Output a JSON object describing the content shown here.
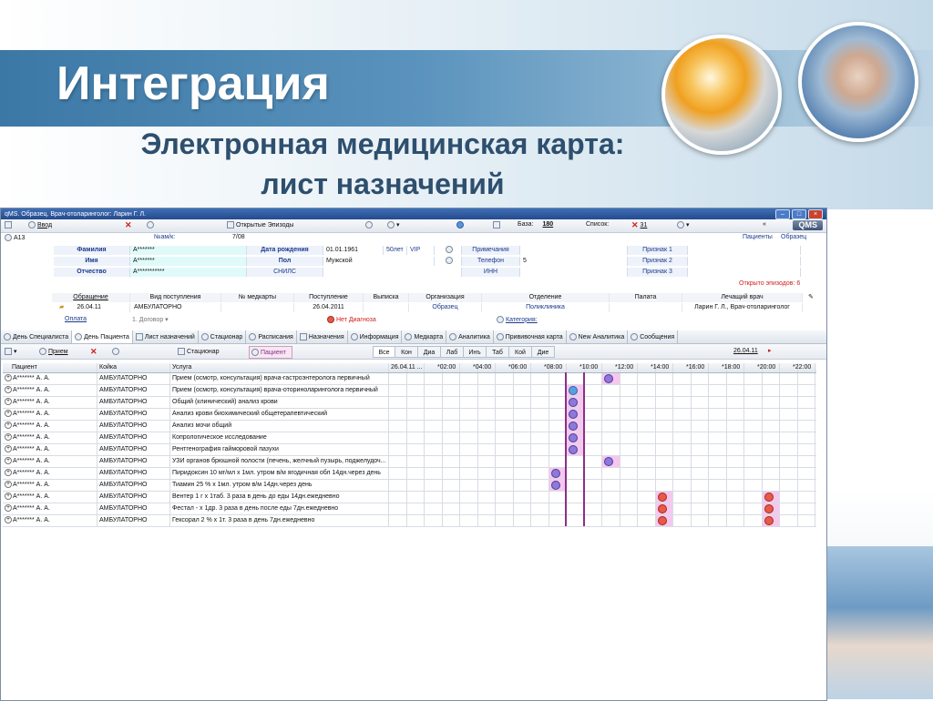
{
  "slide": {
    "title": "Интеграция",
    "subtitle_line1": "Электронная медицинская карта:",
    "subtitle_line2": "лист назначений"
  },
  "window": {
    "title": "qMS. Образец. Врач-отоларинголог: Ларин Г. Л.",
    "logo": "QMS"
  },
  "toolbar": {
    "vvod": "Ввод",
    "open_episodes": "Открытые Эпизоды",
    "baza_label": "База:",
    "baza_value": "180",
    "spisok_label": "Список:",
    "spisok_value": "31"
  },
  "patient": {
    "a13": "A13",
    "nam_label": "№ам/к:",
    "nam_value": "7/08",
    "links_right": [
      "Пациенты",
      "Образец"
    ],
    "fields": [
      {
        "label": "Фамилия",
        "value": "А*******"
      },
      {
        "label": "Имя",
        "value": "А*******"
      },
      {
        "label": "Отчество",
        "value": "А***********"
      }
    ],
    "dob_label": "Дата рождения",
    "dob_value": "01.01.1961",
    "age": "50лет",
    "vip": "VIP",
    "sex_label": "Пол",
    "sex_value": "Мужской",
    "snils_label": "СНИЛС",
    "notes_label": "Примечания",
    "phone_label": "Телефон",
    "phone_value": "5",
    "inn_label": "ИНН",
    "signs": [
      "Признак 1",
      "Признак 2",
      "Признак 3"
    ],
    "open_episodes_note": "Открыто эпизодов: 6"
  },
  "episode": {
    "headers": [
      "Обращение",
      "Вид поступления",
      "№ медкарты",
      "Поступление",
      "Выписка",
      "Организация",
      "Отделение",
      "Палата",
      "Лечащий врач"
    ],
    "row": {
      "date": "26.04.11",
      "type": "АМБУЛАТОРНО",
      "admission": "26.04.2011",
      "organization": "Образец",
      "department": "Поликлиника",
      "doctor": "Ларин Г. Л., Врач-отоларинголог"
    },
    "payment": "Оплата",
    "contract": "1. Договор",
    "no_diagnosis": "Нет Диагноза",
    "category": "Категория:"
  },
  "tabs": [
    "День Специалиста",
    "День Пациента",
    "Лист назначений",
    "Стационар",
    "Расписания",
    "Назначения",
    "Информация",
    "Медкарта",
    "Аналитика",
    "Прививочная карта",
    "New Аналитика",
    "Сообщения"
  ],
  "active_tab": "День Пациента",
  "toolbar2": {
    "priem": "Прием",
    "stacionar": "Стационар",
    "pacient": "Пациент",
    "filters": [
      "Все",
      "Кон",
      "Диа",
      "Лаб",
      "Инъ",
      "Таб",
      "Кой",
      "Дие"
    ],
    "date": "26.04.11"
  },
  "grid": {
    "headers": {
      "patient": "Пациент",
      "bed": "Койка",
      "service": "Услуга"
    },
    "time_labels": [
      "26.04.11 ...",
      "*02:00",
      "*04:00",
      "*06:00",
      "*08:00",
      "*10:00",
      "*12:00",
      "*14:00",
      "*16:00",
      "*18:00",
      "*20:00",
      "*22:00"
    ],
    "rows": [
      {
        "patient": "А******* А. А.",
        "bed": "АМБУЛАТОРНО",
        "service": "Прием (осмотр, консультация) врача-гастроэнтеролога первичный",
        "markers": [
          {
            "slot": 12,
            "color": "purple"
          }
        ]
      },
      {
        "patient": "А******* А. А.",
        "bed": "АМБУЛАТОРНО",
        "service": "Прием (осмотр, консультация) врача-оториноларинголога первичный",
        "markers": [
          {
            "slot": 10,
            "color": "blue"
          }
        ]
      },
      {
        "patient": "А******* А. А.",
        "bed": "АМБУЛАТОРНО",
        "service": "Общий (клинический) анализ крови",
        "markers": [
          {
            "slot": 10,
            "color": "purple"
          }
        ]
      },
      {
        "patient": "А******* А. А.",
        "bed": "АМБУЛАТОРНО",
        "service": "Анализ крови биохимический общетерапевтический",
        "markers": [
          {
            "slot": 10,
            "color": "purple"
          }
        ]
      },
      {
        "patient": "А******* А. А.",
        "bed": "АМБУЛАТОРНО",
        "service": "Анализ мочи общий",
        "markers": [
          {
            "slot": 10,
            "color": "purple"
          }
        ]
      },
      {
        "patient": "А******* А. А.",
        "bed": "АМБУЛАТОРНО",
        "service": "Копрологическое исследование",
        "markers": [
          {
            "slot": 10,
            "color": "purple"
          }
        ]
      },
      {
        "patient": "А******* А. А.",
        "bed": "АМБУЛАТОРНО",
        "service": "Рентгенография гайморовой пазухи",
        "markers": [
          {
            "slot": 10,
            "color": "purple"
          }
        ]
      },
      {
        "patient": "А******* А. А.",
        "bed": "АМБУЛАТОРНО",
        "service": "УЗИ органов брюшной полости (печень, желчный пузырь, поджелудоч...",
        "markers": [
          {
            "slot": 12,
            "color": "purple"
          }
        ]
      },
      {
        "patient": "А******* А. А.",
        "bed": "АМБУЛАТОРНО",
        "service": "Пиридоксин 10 мг/мл х 1мл. утром в/м ягодичная обл 14дн.через день",
        "markers": [
          {
            "slot": 9,
            "color": "purple"
          }
        ]
      },
      {
        "patient": "А******* А. А.",
        "bed": "АМБУЛАТОРНО",
        "service": "Тиамин 25 % х 1мл. утром в/м 14дн.через день",
        "markers": [
          {
            "slot": 9,
            "color": "purple"
          }
        ]
      },
      {
        "patient": "А******* А. А.",
        "bed": "АМБУЛАТОРНО",
        "service": "Вентер 1 г х 1таб. 3 раза в день до еды 14дн.ежедневно",
        "markers": [
          {
            "slot": 15,
            "color": "red"
          },
          {
            "slot": 21,
            "color": "red"
          }
        ]
      },
      {
        "patient": "А******* А. А.",
        "bed": "АМБУЛАТОРНО",
        "service": "Фестал - х 1др. 3 раза в день после еды 7дн.ежедневно",
        "markers": [
          {
            "slot": 15,
            "color": "red"
          },
          {
            "slot": 21,
            "color": "red"
          }
        ]
      },
      {
        "patient": "А******* А. А.",
        "bed": "АМБУЛАТОРНО",
        "service": "Гексорал 2 % х 1т. 3 раза в день 7дн.ежедневно",
        "markers": [
          {
            "slot": 15,
            "color": "red"
          },
          {
            "slot": 21,
            "color": "red"
          }
        ]
      }
    ]
  },
  "colors": {
    "accent": "#3c78a6",
    "marker_purple": "#8d7ad8",
    "marker_blue": "#5aa0e0",
    "marker_red": "#e85a48",
    "highlight_pink": "#f6c8ee"
  }
}
